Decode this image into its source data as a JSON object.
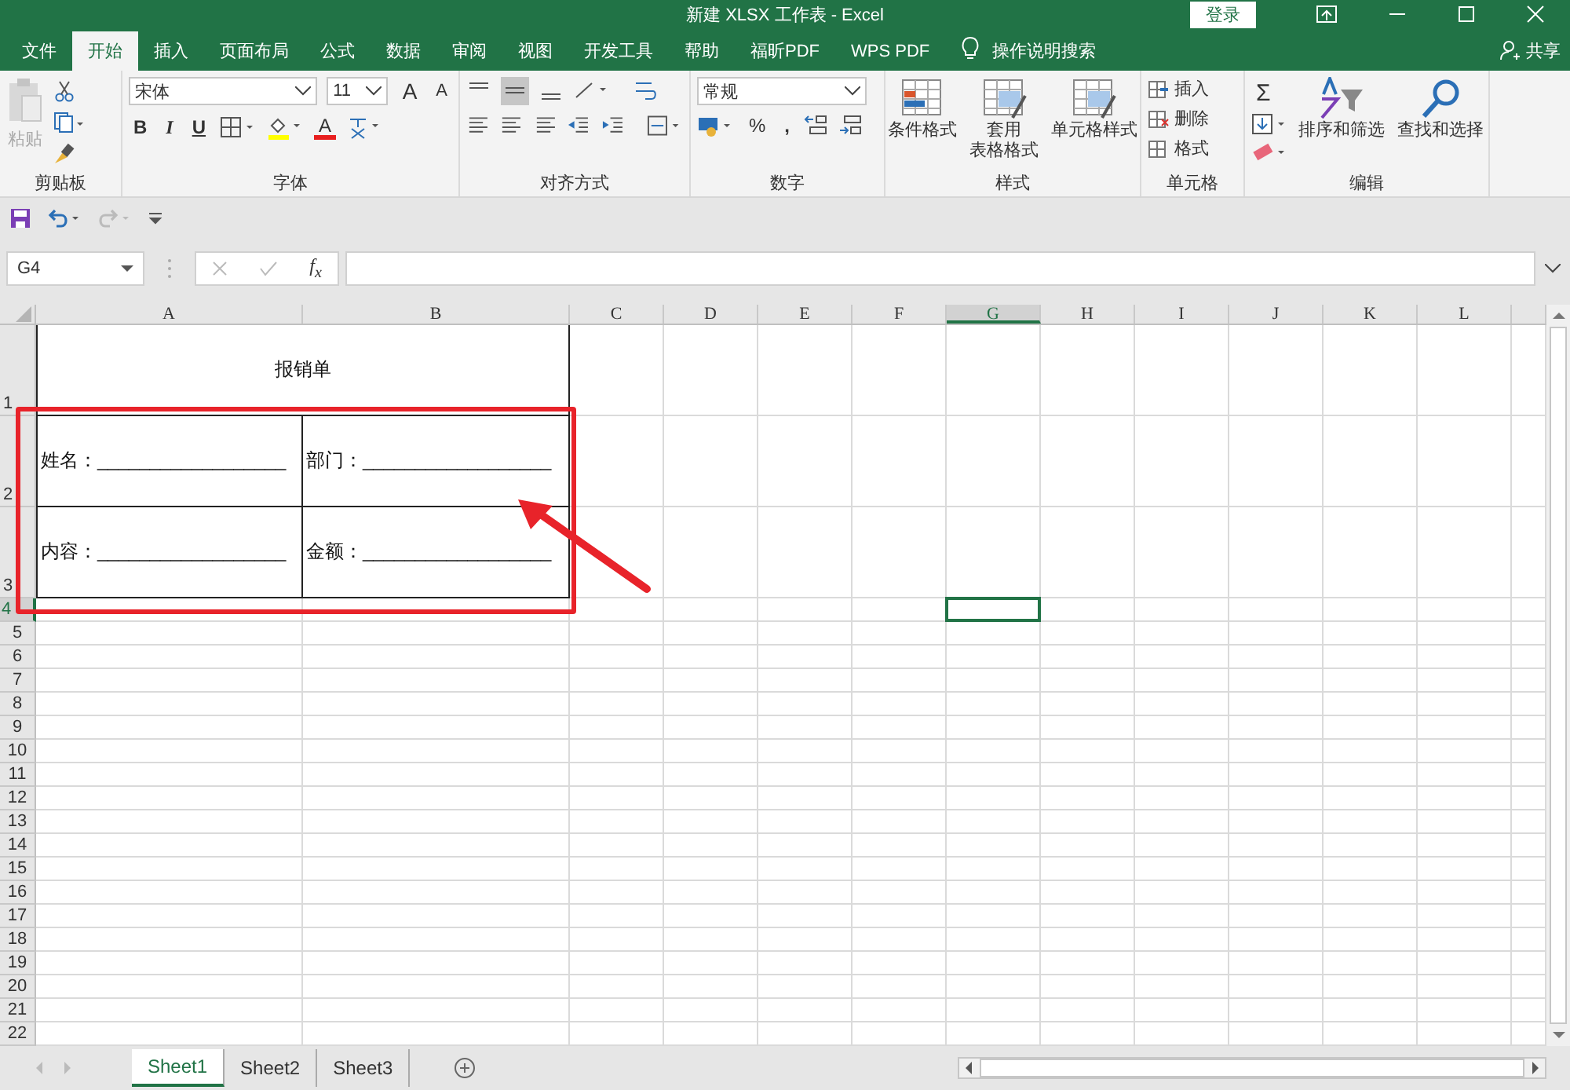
{
  "window": {
    "title": "新建 XLSX 工作表  -  Excel",
    "login": "登录"
  },
  "tabs": [
    {
      "label": "文件",
      "selected": false
    },
    {
      "label": "开始",
      "selected": true
    },
    {
      "label": "插入",
      "selected": false
    },
    {
      "label": "页面布局",
      "selected": false
    },
    {
      "label": "公式",
      "selected": false
    },
    {
      "label": "数据",
      "selected": false
    },
    {
      "label": "审阅",
      "selected": false
    },
    {
      "label": "视图",
      "selected": false
    },
    {
      "label": "开发工具",
      "selected": false
    },
    {
      "label": "帮助",
      "selected": false
    },
    {
      "label": "福昕PDF",
      "selected": false
    },
    {
      "label": "WPS PDF",
      "selected": false
    }
  ],
  "tell_me": "操作说明搜索",
  "share": "共享",
  "ribbon": {
    "clipboard": {
      "label": "剪贴板",
      "paste": "粘贴"
    },
    "font": {
      "label": "字体",
      "name": "宋体",
      "size": "11",
      "grow": "A",
      "shrink": "A",
      "bold": "B",
      "italic": "I",
      "underline": "U",
      "font_color_label": "A"
    },
    "alignment": {
      "label": "对齐方式"
    },
    "number": {
      "label": "数字",
      "format": "常规",
      "percent": "%",
      "comma": ","
    },
    "styles": {
      "label": "样式",
      "buttons": [
        [
          "条件格式"
        ],
        [
          "套用",
          "表格格式"
        ],
        [
          "单元格样式"
        ]
      ]
    },
    "cells": {
      "label": "单元格",
      "buttons": [
        "插入",
        "删除",
        "格式"
      ]
    },
    "editing": {
      "label": "编辑",
      "sum": "Σ",
      "buttons": [
        "排序和筛选",
        "查找和选择"
      ]
    }
  },
  "name_box": "G4",
  "function_label": "f$_{x}$",
  "columns": [
    {
      "label": "A",
      "selected": false
    },
    {
      "label": "B",
      "selected": false
    },
    {
      "label": "C",
      "selected": false
    },
    {
      "label": "D",
      "selected": false
    },
    {
      "label": "E",
      "selected": false
    },
    {
      "label": "F",
      "selected": false
    },
    {
      "label": "G",
      "selected": true
    },
    {
      "label": "H",
      "selected": false
    },
    {
      "label": "I",
      "selected": false
    },
    {
      "label": "J",
      "selected": false
    },
    {
      "label": "K",
      "selected": false
    },
    {
      "label": "L",
      "selected": false
    }
  ],
  "rows": [
    {
      "label": "1",
      "selected": false,
      "cells": [
        {
          "text": "报销单",
          "merged": true
        }
      ]
    },
    {
      "label": "2",
      "selected": false,
      "cells": [
        {
          "text": "姓名：__________________"
        },
        {
          "text": "部门：__________________"
        }
      ]
    },
    {
      "label": "3",
      "selected": false,
      "cells": [
        {
          "text": "内容：__________________"
        },
        {
          "text": "金额：__________________"
        }
      ]
    },
    {
      "label": "4",
      "selected": true
    },
    {
      "label": "5",
      "selected": false
    },
    {
      "label": "6",
      "selected": false
    },
    {
      "label": "7",
      "selected": false
    },
    {
      "label": "8",
      "selected": false
    },
    {
      "label": "9",
      "selected": false
    },
    {
      "label": "10",
      "selected": false
    },
    {
      "label": "11",
      "selected": false
    },
    {
      "label": "12",
      "selected": false
    },
    {
      "label": "13",
      "selected": false
    },
    {
      "label": "14",
      "selected": false
    },
    {
      "label": "15",
      "selected": false
    },
    {
      "label": "16",
      "selected": false
    },
    {
      "label": "17",
      "selected": false
    },
    {
      "label": "18",
      "selected": false
    },
    {
      "label": "19",
      "selected": false
    },
    {
      "label": "20",
      "selected": false
    },
    {
      "label": "21",
      "selected": false
    },
    {
      "label": "22",
      "selected": false
    }
  ],
  "sheets": [
    {
      "label": "Sheet1",
      "selected": true
    },
    {
      "label": "Sheet2",
      "selected": false
    },
    {
      "label": "Sheet3",
      "selected": false
    }
  ]
}
